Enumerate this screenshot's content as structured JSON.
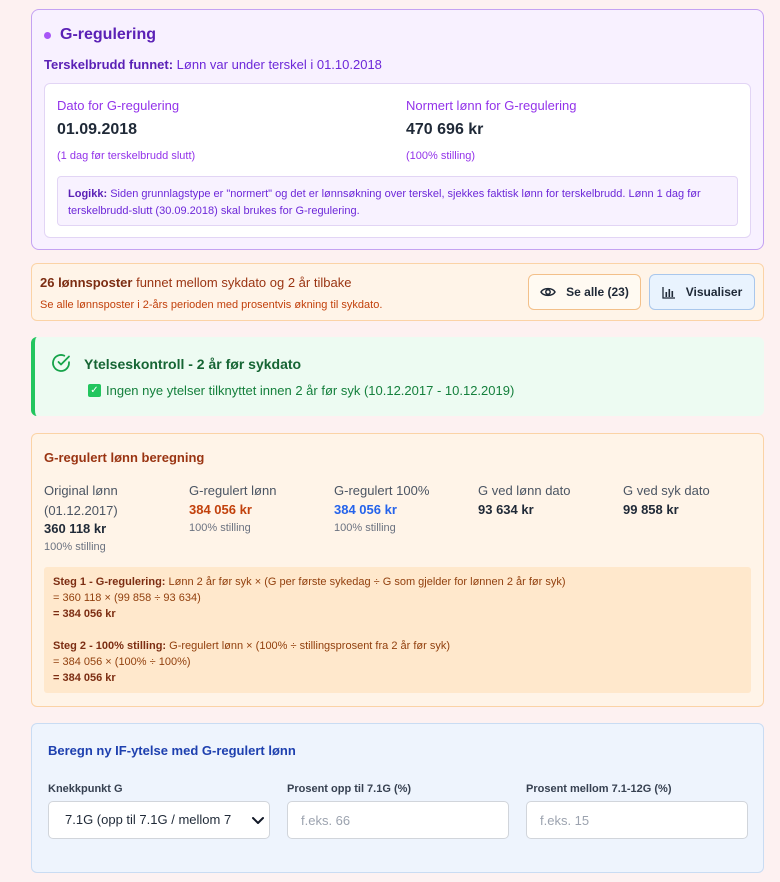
{
  "greg": {
    "title": "G-regulering",
    "threshold_label": "Terskelbrudd funnet:",
    "threshold_text": "Lønn var under terskel i 01.10.2018",
    "date_label": "Dato for G-regulering",
    "date_value": "01.09.2018",
    "date_note": "(1 dag før terskelbrudd slutt)",
    "salary_label": "Normert lønn for G-regulering",
    "salary_value": "470 696 kr",
    "salary_note": "(100% stilling)",
    "logic_label": "Logikk:",
    "logic_text": "Siden grunnlagstype er \"normert\" og det er lønnsøkning over terskel, sjekkes faktisk lønn for terskelbrudd. Lønn 1 dag før terskelbrudd-slutt (30.09.2018) skal brukes for G-regulering."
  },
  "lonnsposter": {
    "count_text": "26 lønnsposter",
    "title_rest": "funnet mellom sykdato og 2 år tilbake",
    "subtitle": "Se alle lønnsposter i 2-års perioden med prosentvis økning til sykdato.",
    "see_all_label": "Se alle (23)",
    "visualize_label": "Visualiser"
  },
  "ytelse": {
    "title": "Ytelseskontroll - 2 år før sykdato",
    "check_text": "Ingen nye ytelser tilknyttet innen 2 år før syk (10.12.2017 - 10.12.2019)"
  },
  "calc": {
    "title": "G-regulert lønn beregning",
    "columns": [
      {
        "label": "Original lønn (01.12.2017)",
        "value": "360 118 kr",
        "sub": "100% stilling"
      },
      {
        "label": "G-regulert lønn",
        "value": "384 056 kr",
        "sub": "100% stilling"
      },
      {
        "label": "G-regulert 100%",
        "value": "384 056 kr",
        "sub": "100% stilling"
      },
      {
        "label": "G ved lønn dato",
        "value": "93 634 kr"
      },
      {
        "label": "G ved syk dato",
        "value": "99 858 kr"
      }
    ],
    "step1_label": "Steg 1 - G-regulering:",
    "step1_formula": "Lønn 2 år før syk × (G per første sykedag ÷ G som gjelder for lønnen 2 år før syk)",
    "step1_line2": "= 360 118 × (99 858 ÷ 93 634)",
    "step1_result": "= 384 056 kr",
    "step2_label": "Steg 2 - 100% stilling:",
    "step2_formula": "G-regulert lønn × (100% ÷ stillingsprosent fra 2 år før syk)",
    "step2_line2": "= 384 056 × (100% ÷ 100%)",
    "step2_result": "= 384 056 kr"
  },
  "if_form": {
    "title": "Beregn ny IF-ytelse med G-regulert lønn",
    "knekkpunkt_label": "Knekkpunkt G",
    "knekkpunkt_value": "7.1G (opp til 7.1G / mellom 7",
    "pct_low_label": "Prosent opp til 7.1G (%)",
    "pct_low_placeholder": "f.eks. 66",
    "pct_mid_label": "Prosent mellom 7.1-12G (%)",
    "pct_mid_placeholder": "f.eks. 15"
  }
}
